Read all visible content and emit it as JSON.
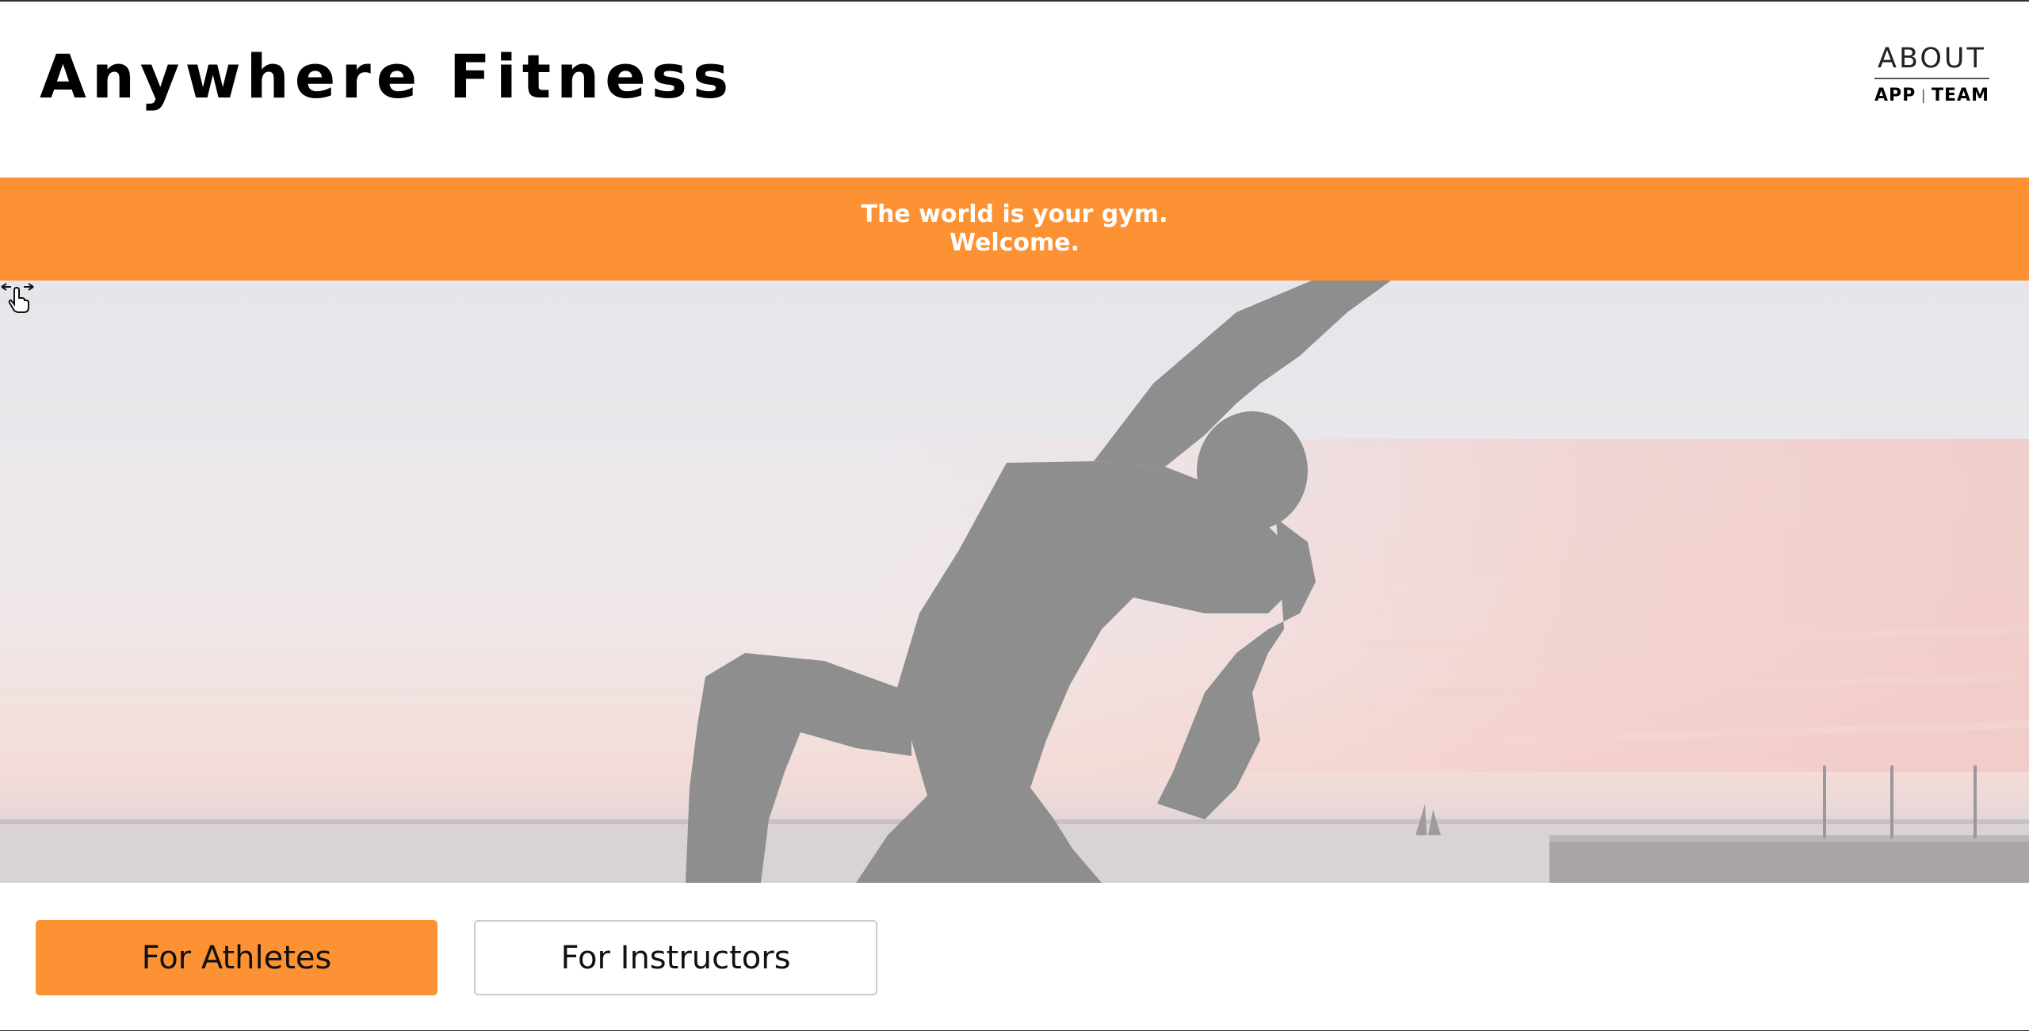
{
  "header": {
    "logo": "Anywhere Fitness",
    "about": {
      "title": "ABOUT",
      "links": [
        "APP",
        "TEAM"
      ],
      "separator": "|"
    }
  },
  "banner": {
    "line1": "The world is your gym.",
    "line2": "Welcome.",
    "background": "#fc9233"
  },
  "hero": {
    "image": "yoga-silhouette-sunset",
    "cursor_icon": "hand-pointer-horizontal-resize-icon"
  },
  "actions": {
    "athletes_label": "For Athletes",
    "instructors_label": "For Instructors"
  },
  "colors": {
    "accent": "#fc9233",
    "text": "#000000"
  }
}
